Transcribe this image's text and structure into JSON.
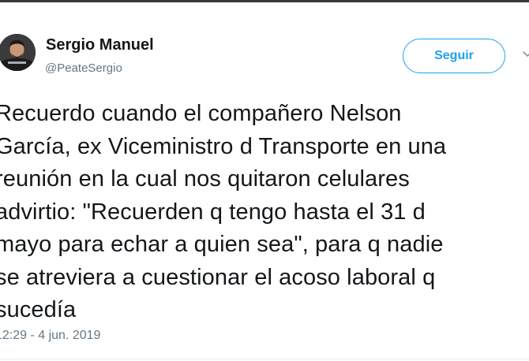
{
  "user": {
    "name": "Sergio Manuel",
    "handle": "@PeateSergio"
  },
  "follow_button": {
    "label": "Seguir"
  },
  "tweet": {
    "text": "Recuerdo cuando el compañero Nelson\nGarcía, ex Viceministro d Transporte en una\nreunión en la cual nos quitaron celulares\nadvirtio: \"Recuerden q tengo hasta el 31 d\nmayo para echar a quien sea\", para q nadie\nse atreviera a cuestionar el acoso laboral q\nsucedía",
    "timestamp": "12:29 - 4 jun. 2019"
  },
  "icons": {
    "avatar": "profile-photo",
    "menu": "chevron-down-icon"
  },
  "colors": {
    "accent": "#1da1f2",
    "text": "#14171a",
    "secondary_text": "#657786"
  }
}
